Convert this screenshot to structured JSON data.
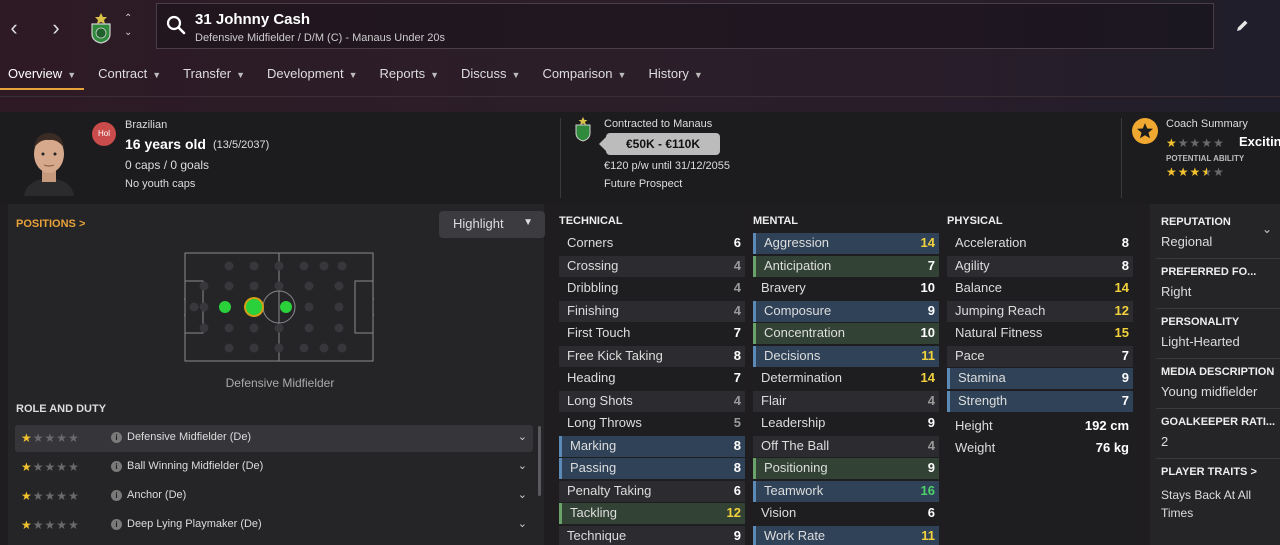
{
  "header": {
    "name": "31 Johnny Cash",
    "desc": "Defensive Midfielder / D/M (C) - Manaus Under 20s"
  },
  "tabs": [
    {
      "label": "Overview"
    },
    {
      "label": "Contract"
    },
    {
      "label": "Transfer"
    },
    {
      "label": "Development"
    },
    {
      "label": "Reports"
    },
    {
      "label": "Discuss"
    },
    {
      "label": "Comparison"
    },
    {
      "label": "History"
    }
  ],
  "profile": {
    "badge": "Hol",
    "nationality": "Brazilian",
    "age": "16 years old",
    "dob": "(13/5/2037)",
    "caps": "0 caps / 0 goals",
    "youth": "No youth caps",
    "contracted": "Contracted to Manaus",
    "value": "€50K - €110K",
    "wage": "€120 p/w until 31/12/2055",
    "status": "Future Prospect",
    "coach_title": "Coach Summary",
    "coach_word": "Excitin",
    "potential_label": "POTENTIAL ABILITY",
    "current_stars": 1,
    "potential_stars": 3.5
  },
  "positions": {
    "label": "POSITIONS >",
    "highlight": "Highlight",
    "caption": "Defensive Midfielder"
  },
  "roles": {
    "heading": "ROLE AND DUTY",
    "items": [
      {
        "name": "Defensive Midfielder (De)",
        "stars": 1
      },
      {
        "name": "Ball Winning Midfielder (De)",
        "stars": 1
      },
      {
        "name": "Anchor (De)",
        "stars": 1
      },
      {
        "name": "Deep Lying Playmaker (De)",
        "stars": 1
      }
    ]
  },
  "technical": {
    "heading": "TECHNICAL",
    "attrs": [
      {
        "n": "Corners",
        "v": "6",
        "c": "",
        "h": ""
      },
      {
        "n": "Crossing",
        "v": "4",
        "c": "dim",
        "h": ""
      },
      {
        "n": "Dribbling",
        "v": "4",
        "c": "dim",
        "h": ""
      },
      {
        "n": "Finishing",
        "v": "4",
        "c": "dim",
        "h": ""
      },
      {
        "n": "First Touch",
        "v": "7",
        "c": "",
        "h": ""
      },
      {
        "n": "Free Kick Taking",
        "v": "8",
        "c": "",
        "h": ""
      },
      {
        "n": "Heading",
        "v": "7",
        "c": "",
        "h": ""
      },
      {
        "n": "Long Shots",
        "v": "4",
        "c": "dim",
        "h": ""
      },
      {
        "n": "Long Throws",
        "v": "5",
        "c": "dim",
        "h": ""
      },
      {
        "n": "Marking",
        "v": "8",
        "c": "",
        "h": "blue"
      },
      {
        "n": "Passing",
        "v": "8",
        "c": "",
        "h": "blue"
      },
      {
        "n": "Penalty Taking",
        "v": "6",
        "c": "",
        "h": ""
      },
      {
        "n": "Tackling",
        "v": "12",
        "c": "yel",
        "h": "green"
      },
      {
        "n": "Technique",
        "v": "9",
        "c": "",
        "h": ""
      }
    ]
  },
  "mental": {
    "heading": "MENTAL",
    "attrs": [
      {
        "n": "Aggression",
        "v": "14",
        "c": "yel",
        "h": "blue"
      },
      {
        "n": "Anticipation",
        "v": "7",
        "c": "",
        "h": "green"
      },
      {
        "n": "Bravery",
        "v": "10",
        "c": "",
        "h": ""
      },
      {
        "n": "Composure",
        "v": "9",
        "c": "",
        "h": "blue"
      },
      {
        "n": "Concentration",
        "v": "10",
        "c": "",
        "h": "green"
      },
      {
        "n": "Decisions",
        "v": "11",
        "c": "yel",
        "h": "blue"
      },
      {
        "n": "Determination",
        "v": "14",
        "c": "yel",
        "h": ""
      },
      {
        "n": "Flair",
        "v": "4",
        "c": "dim",
        "h": ""
      },
      {
        "n": "Leadership",
        "v": "9",
        "c": "",
        "h": ""
      },
      {
        "n": "Off The Ball",
        "v": "4",
        "c": "dim",
        "h": ""
      },
      {
        "n": "Positioning",
        "v": "9",
        "c": "",
        "h": "green"
      },
      {
        "n": "Teamwork",
        "v": "16",
        "c": "grn",
        "h": "blue"
      },
      {
        "n": "Vision",
        "v": "6",
        "c": "",
        "h": ""
      },
      {
        "n": "Work Rate",
        "v": "11",
        "c": "yel",
        "h": "blue"
      }
    ]
  },
  "physical": {
    "heading": "PHYSICAL",
    "attrs": [
      {
        "n": "Acceleration",
        "v": "8",
        "c": "",
        "h": ""
      },
      {
        "n": "Agility",
        "v": "8",
        "c": "",
        "h": ""
      },
      {
        "n": "Balance",
        "v": "14",
        "c": "yel",
        "h": ""
      },
      {
        "n": "Jumping Reach",
        "v": "12",
        "c": "yel",
        "h": ""
      },
      {
        "n": "Natural Fitness",
        "v": "15",
        "c": "yel",
        "h": ""
      },
      {
        "n": "Pace",
        "v": "7",
        "c": "",
        "h": ""
      },
      {
        "n": "Stamina",
        "v": "9",
        "c": "",
        "h": "blue"
      },
      {
        "n": "Strength",
        "v": "7",
        "c": "",
        "h": "blue"
      }
    ],
    "height_label": "Height",
    "height": "192 cm",
    "weight_label": "Weight",
    "weight": "76 kg"
  },
  "info": {
    "reputation_label": "REPUTATION",
    "reputation": "Regional",
    "foot_label": "PREFERRED FO...",
    "foot": "Right",
    "personality_label": "PERSONALITY",
    "personality": "Light-Hearted",
    "media_label": "MEDIA DESCRIPTION",
    "media": "Young midfielder",
    "gk_label": "GOALKEEPER RATI...",
    "gk": "2",
    "traits_label": "PLAYER TRAITS >",
    "traits": [
      "Stays Back At All",
      "Times"
    ]
  },
  "colors": {
    "accent": "#e8a23a",
    "highlight_blue": "#2f4257",
    "highlight_green": "#324234",
    "yellow": "#f2d23c",
    "green": "#4fd16a"
  }
}
